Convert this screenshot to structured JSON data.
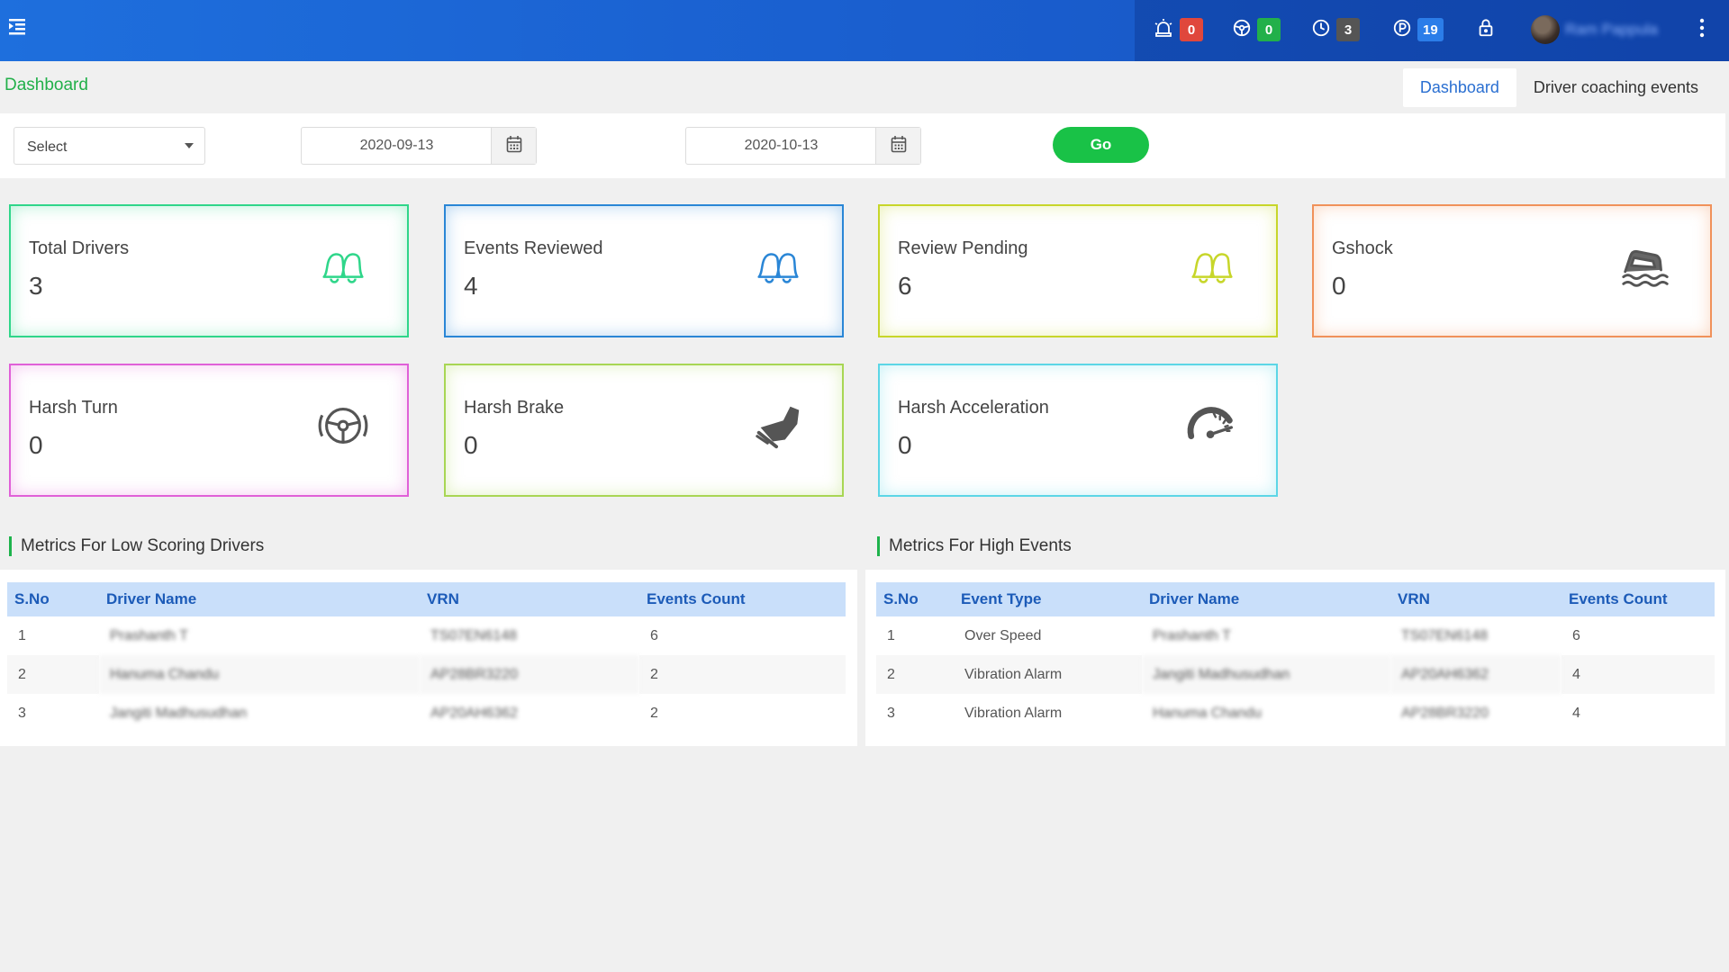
{
  "topbar": {
    "menu_icon": "menu-collapse-icon",
    "nav": [
      {
        "icon": "alarm-light-icon",
        "count": "0",
        "color": "#e0473c"
      },
      {
        "icon": "steering-wheel-icon",
        "count": "0",
        "color": "#22b04a"
      },
      {
        "icon": "clock-icon",
        "count": "3",
        "color": "#555555"
      },
      {
        "icon": "parking-icon",
        "count": "19",
        "color": "#2b7de9"
      }
    ],
    "lock_icon": "lock-icon",
    "user_name": "Ram Pappula",
    "more_icon": "kebab-menu-icon"
  },
  "breadcrumb": "Dashboard",
  "tabs": [
    {
      "label": "Dashboard",
      "active": true
    },
    {
      "label": "Driver coaching events",
      "active": false
    }
  ],
  "filters": {
    "select_label": "Select",
    "start_date": "2020-09-13",
    "end_date": "2020-10-13",
    "go_label": "Go"
  },
  "cards": [
    {
      "label": "Total Drivers",
      "value": "3",
      "icon": "bell-icon",
      "color": "#2fd68a"
    },
    {
      "label": "Events Reviewed",
      "value": "4",
      "icon": "bell-icon",
      "color": "#2a86d6"
    },
    {
      "label": "Review Pending",
      "value": "6",
      "icon": "bell-icon",
      "color": "#c7d62a"
    },
    {
      "label": "Gshock",
      "value": "0",
      "icon": "car-water-icon",
      "color": "#f0915a"
    },
    {
      "label": "Harsh Turn",
      "value": "0",
      "icon": "steering-wheel-icon",
      "color": "#e060d8"
    },
    {
      "label": "Harsh Brake",
      "value": "0",
      "icon": "brake-pedal-icon",
      "color": "#a8d654"
    },
    {
      "label": "Harsh Acceleration",
      "value": "0",
      "icon": "speedometer-icon",
      "color": "#5cd6e6"
    }
  ],
  "low_scoring": {
    "title": "Metrics For Low Scoring Drivers",
    "columns": [
      "S.No",
      "Driver Name",
      "VRN",
      "Events Count"
    ],
    "rows": [
      [
        "1",
        "Prashanth T",
        "TS07EN6148",
        "6"
      ],
      [
        "2",
        "Hanuma Chandu",
        "AP28BR3220",
        "2"
      ],
      [
        "3",
        "Jangiti Madhusudhan",
        "AP20AH6362",
        "2"
      ]
    ]
  },
  "high_events": {
    "title": "Metrics For High Events",
    "columns": [
      "S.No",
      "Event Type",
      "Driver Name",
      "VRN",
      "Events Count"
    ],
    "rows": [
      [
        "1",
        "Over Speed",
        "Prashanth T",
        "TS07EN6148",
        "6"
      ],
      [
        "2",
        "Vibration Alarm",
        "Jangiti Madhusudhan",
        "AP20AH6362",
        "4"
      ],
      [
        "3",
        "Vibration Alarm",
        "Hanuma Chandu",
        "AP28BR3220",
        "4"
      ]
    ]
  }
}
